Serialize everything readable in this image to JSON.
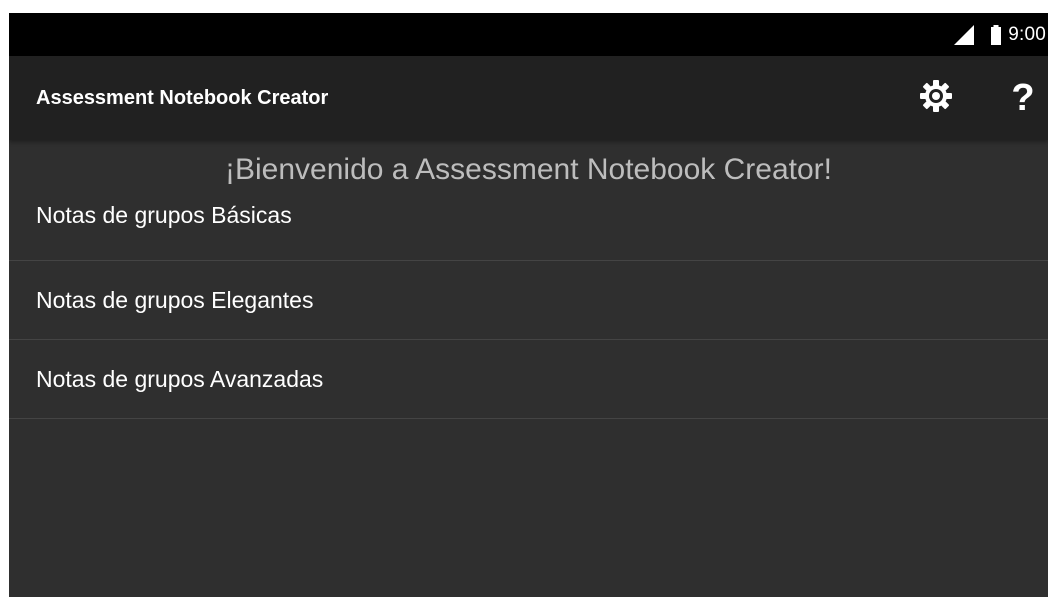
{
  "status_bar": {
    "time": "9:00",
    "signal_icon": "cellular-signal-icon",
    "battery_icon": "battery-icon"
  },
  "app_bar": {
    "title": "Assessment Notebook Creator",
    "settings_icon": "gear-icon",
    "help_label": "?"
  },
  "main": {
    "welcome": "¡Bienvenido a Assessment Notebook Creator!",
    "items": [
      {
        "label": "Notas de grupos Básicas"
      },
      {
        "label": "Notas de grupos Elegantes"
      },
      {
        "label": "Notas de grupos Avanzadas"
      }
    ]
  },
  "colors": {
    "status_bar_bg": "#000000",
    "app_bar_bg": "#212121",
    "content_bg": "#2f2f2f",
    "divider": "#444444",
    "welcome_text": "#bdbdbd",
    "text": "#ffffff"
  }
}
